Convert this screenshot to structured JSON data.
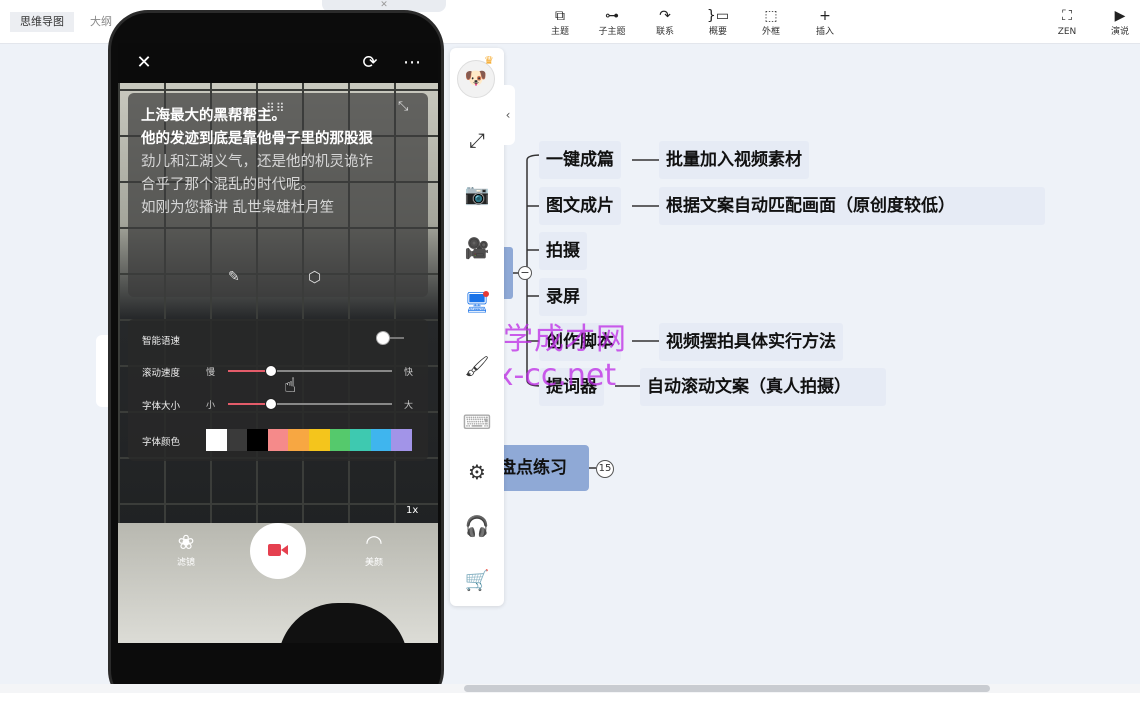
{
  "toolbar": {
    "tabs": [
      "思维导图",
      "大纲"
    ],
    "tools": [
      {
        "label": "主题",
        "icon": "topic-icon"
      },
      {
        "label": "子主题",
        "icon": "subtopic-icon"
      },
      {
        "label": "联系",
        "icon": "relation-icon"
      },
      {
        "label": "概要",
        "icon": "summary-icon"
      },
      {
        "label": "外框",
        "icon": "frame-icon"
      },
      {
        "label": "插入",
        "icon": "plus-icon"
      }
    ],
    "right_tools": [
      {
        "label": "ZEN",
        "icon": "fullscreen-icon"
      },
      {
        "label": "演说",
        "icon": "present-icon"
      }
    ]
  },
  "mindmap": {
    "branches": [
      {
        "label": "一键成篇",
        "leaf": "批量加入视频素材"
      },
      {
        "label": "图文成片",
        "leaf": "根据文案自动匹配画面（原创度较低）"
      },
      {
        "label": "拍摄",
        "leaf": ""
      },
      {
        "label": "录屏",
        "leaf": ""
      },
      {
        "label": "创作脚本",
        "leaf": "视频摆拍具体实行方法"
      },
      {
        "label": "提词器",
        "leaf": "自动滚动文案（真人拍摄）"
      }
    ],
    "central": "盘点练习",
    "badge": "15",
    "collapse_glyph": "−"
  },
  "watermark": {
    "line1": "自学成才网",
    "line2": "zx-cc.net"
  },
  "phone": {
    "prompt_lines": [
      {
        "text": "他的发迹到底是靠他骨子里的那股狠",
        "style": "bold"
      }
    ],
    "prompt": {
      "line0": "上海最大的黑帮帮主。",
      "line1": "他的发迹到底是靠他骨子里的那股狠",
      "line2": "劲儿和江湖义气，还是他的机灵诡诈",
      "line3": "合乎了那个混乱的时代呢。",
      "line4": "如刚为您播讲  乱世枭雄杜月笙"
    },
    "settings": {
      "smart_speed": "智能语速",
      "scroll_speed": "滚动速度",
      "slow": "慢",
      "fast": "快",
      "font_size": "字体大小",
      "small": "小",
      "large": "大",
      "font_color": "字体颜色",
      "scroll_speed_value": 0.26,
      "font_size_value": 0.26,
      "colors": [
        "#ffffff",
        "#3a3a3a",
        "#000000",
        "#f58a8a",
        "#f7a742",
        "#f4c51c",
        "#55c96c",
        "#3ec9b0",
        "#3fb5ee",
        "#a294e8"
      ]
    },
    "zoom": "1x",
    "filter_label": "滤镜",
    "beauty_label": "美颜"
  }
}
